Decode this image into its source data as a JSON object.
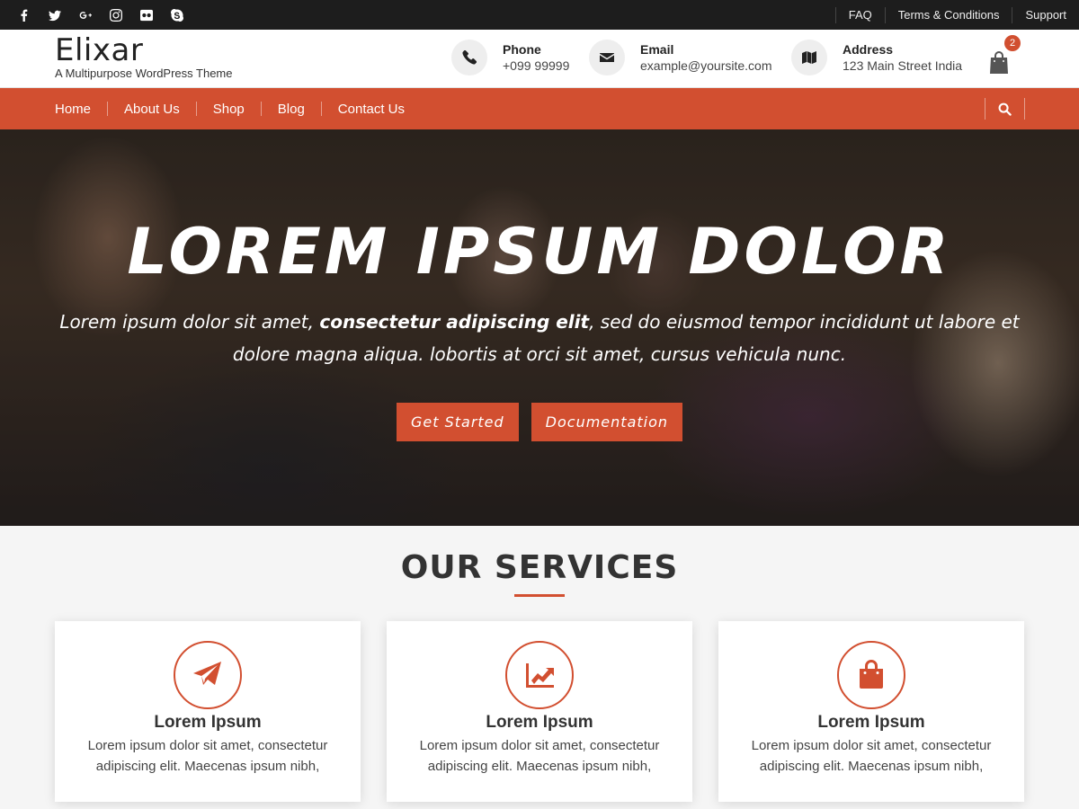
{
  "topbar": {
    "social": [
      {
        "icon": "facebook-icon",
        "glyph": "f"
      },
      {
        "icon": "twitter-icon",
        "glyph": "t"
      },
      {
        "icon": "google-plus-icon",
        "glyph": "G+"
      },
      {
        "icon": "instagram-icon",
        "glyph": "ig"
      },
      {
        "icon": "flickr-icon",
        "glyph": "fl"
      },
      {
        "icon": "skype-icon",
        "glyph": "s"
      }
    ],
    "links": [
      "FAQ",
      "Terms & Conditions",
      "Support"
    ]
  },
  "header": {
    "logo": "Elixar",
    "tagline": "A Multipurpose WordPress Theme",
    "phone": {
      "label": "Phone",
      "value": "+099 99999",
      "icon": "phone-icon"
    },
    "email": {
      "label": "Email",
      "value": "example@yoursite.com",
      "icon": "envelope-icon"
    },
    "address": {
      "label": "Address",
      "value": "123 Main Street India",
      "icon": "map-icon"
    },
    "cart_count": "2"
  },
  "nav": {
    "items": [
      "Home",
      "About Us",
      "Shop",
      "Blog",
      "Contact Us"
    ]
  },
  "hero": {
    "title": "LOREM IPSUM DOLOR",
    "subtitle_pre": "Lorem ipsum dolor sit amet, ",
    "subtitle_bold": "consectetur adipiscing elit",
    "subtitle_post": ", sed do eiusmod tempor incididunt ut labore et dolore magna aliqua. lobortis at orci sit amet, cursus vehicula nunc.",
    "btn_primary": "Get Started",
    "btn_secondary": "Documentation"
  },
  "services": {
    "title": "OUR SERVICES",
    "cards": [
      {
        "icon": "paper-plane-icon",
        "title": "Lorem Ipsum",
        "text": "Lorem ipsum dolor sit amet, consectetur adipiscing elit. Maecenas ipsum nibh,"
      },
      {
        "icon": "line-chart-icon",
        "title": "Lorem Ipsum",
        "text": "Lorem ipsum dolor sit amet, consectetur adipiscing elit. Maecenas ipsum nibh,"
      },
      {
        "icon": "shopping-bag-icon",
        "title": "Lorem Ipsum",
        "text": "Lorem ipsum dolor sit amet, consectetur adipiscing elit. Maecenas ipsum nibh,"
      }
    ]
  },
  "colors": {
    "accent": "#d24f30",
    "topbar": "#1d1d1d"
  }
}
